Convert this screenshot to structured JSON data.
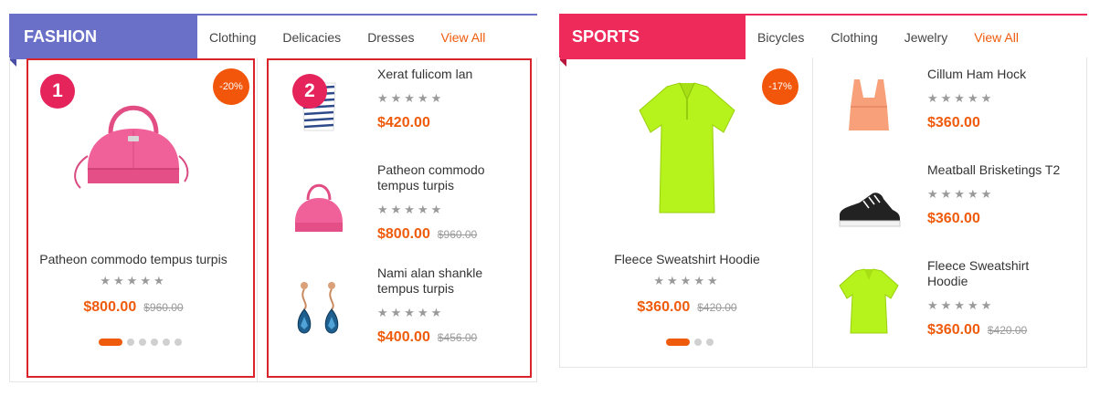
{
  "colors": {
    "fashion": "#6a6fc7",
    "sports": "#ee2a5a",
    "accent": "#ef5b0c",
    "badge": "#f2560b",
    "highlight": "#d9242b",
    "marker": "#e5245c"
  },
  "fashion": {
    "title": "FASHION",
    "tabs": [
      {
        "label": "Clothing"
      },
      {
        "label": "Delicacies"
      },
      {
        "label": "Dresses"
      },
      {
        "label": "View All"
      }
    ],
    "featured": {
      "name": "Patheon commodo tempus turpis",
      "stars": "★★★★★",
      "price": "$800.00",
      "old_price": "$960.00",
      "badge": "-20%"
    },
    "items": [
      {
        "name": "Xerat fulicom lan",
        "stars": "★★★★★",
        "price": "$420.00",
        "old_price": ""
      },
      {
        "name": "Patheon commodo tempus turpis",
        "stars": "★★★★★",
        "price": "$800.00",
        "old_price": "$960.00"
      },
      {
        "name": "Nami alan shankle tempus turpis",
        "stars": "★★★★★",
        "price": "$400.00",
        "old_price": "$456.00"
      }
    ]
  },
  "sports": {
    "title": "SPORTS",
    "tabs": [
      {
        "label": "Bicycles"
      },
      {
        "label": "Clothing"
      },
      {
        "label": "Jewelry"
      },
      {
        "label": "View All"
      }
    ],
    "featured": {
      "name": "Fleece Sweatshirt Hoodie",
      "stars": "★★★★★",
      "price": "$360.00",
      "old_price": "$420.00",
      "badge": "-17%"
    },
    "items": [
      {
        "name": "Cillum Ham Hock",
        "stars": "★★★★★",
        "price": "$360.00",
        "old_price": ""
      },
      {
        "name": "Meatball Brisketings T2",
        "stars": "★★★★★",
        "price": "$360.00",
        "old_price": ""
      },
      {
        "name": "Fleece Sweatshirt Hoodie",
        "stars": "★★★★★",
        "price": "$360.00",
        "old_price": "$420.00"
      }
    ]
  },
  "annotations": {
    "marker1": "1",
    "marker2": "2"
  }
}
